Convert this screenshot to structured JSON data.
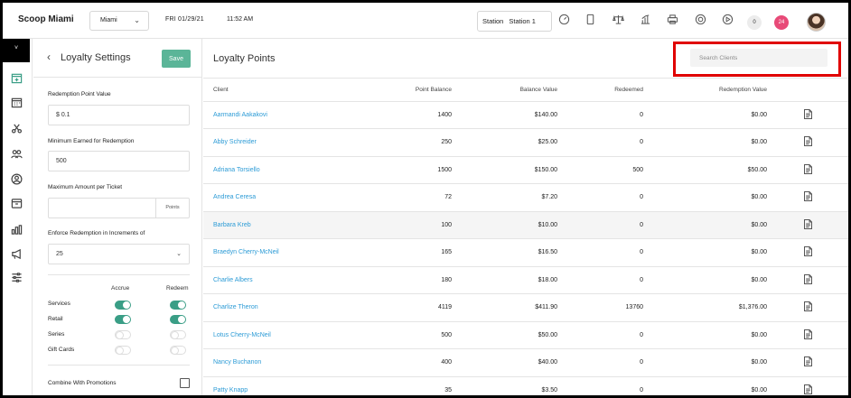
{
  "topbar": {
    "brand": "Scoop Miami",
    "location": "Miami",
    "date": "FRI 01/29/21",
    "time": "11:52 AM",
    "station_label": "Station",
    "station_value": "Station 1",
    "zero_badge": "0",
    "notification_count": "24",
    "icons": [
      "speedometer-icon",
      "tablet-icon",
      "scale-icon",
      "chart-icon",
      "printer-icon",
      "lifebuoy-icon",
      "play-icon"
    ]
  },
  "rail": {
    "toggle_label": "˅",
    "icons": [
      "calendar-plus-icon",
      "calendar-icon",
      "scissors-icon",
      "users-icon",
      "user-circle-icon",
      "box-icon",
      "bar-chart-icon",
      "megaphone-icon",
      "sliders-icon"
    ]
  },
  "settings": {
    "title": "Loyalty Settings",
    "save_label": "Save",
    "redemption_point_value_label": "Redemption Point Value",
    "redemption_point_value": "$ 0.1",
    "minimum_earned_label": "Minimum Earned for Redemption",
    "minimum_earned": "500",
    "max_amount_label": "Maximum Amount per Ticket",
    "max_amount": "",
    "max_amount_suffix": "Points",
    "increments_label": "Enforce Redemption in Increments of",
    "increments_value": "25",
    "accrue_label": "Accrue",
    "redeem_label": "Redeem",
    "categories": [
      {
        "label": "Services",
        "accrue": true,
        "redeem": true
      },
      {
        "label": "Retail",
        "accrue": true,
        "redeem": true
      },
      {
        "label": "Series",
        "accrue": false,
        "redeem": false
      },
      {
        "label": "Gift Cards",
        "accrue": false,
        "redeem": false
      }
    ],
    "combine_label": "Combine With Promotions",
    "combine_checked": false
  },
  "main": {
    "title": "Loyalty Points",
    "search_placeholder": "Search Clients",
    "columns": {
      "client": "Client",
      "point_balance": "Point Balance",
      "balance_value": "Balance Value",
      "redeemed": "Redeemed",
      "redemption_value": "Redemption Value"
    },
    "rows": [
      {
        "client": "Aarmandi Aakakovi",
        "points": "1400",
        "balance": "$140.00",
        "redeemed": "0",
        "redemption": "$0.00"
      },
      {
        "client": "Abby Schreider",
        "points": "250",
        "balance": "$25.00",
        "redeemed": "0",
        "redemption": "$0.00"
      },
      {
        "client": "Adriana Torsiello",
        "points": "1500",
        "balance": "$150.00",
        "redeemed": "500",
        "redemption": "$50.00"
      },
      {
        "client": "Andrea Ceresa",
        "points": "72",
        "balance": "$7.20",
        "redeemed": "0",
        "redemption": "$0.00"
      },
      {
        "client": "Barbara Kreb",
        "points": "100",
        "balance": "$10.00",
        "redeemed": "0",
        "redemption": "$0.00"
      },
      {
        "client": "Braedyn Cherry-McNeil",
        "points": "165",
        "balance": "$16.50",
        "redeemed": "0",
        "redemption": "$0.00"
      },
      {
        "client": "Charlie Albers",
        "points": "180",
        "balance": "$18.00",
        "redeemed": "0",
        "redemption": "$0.00"
      },
      {
        "client": "Charlize Theron",
        "points": "4119",
        "balance": "$411.90",
        "redeemed": "13760",
        "redemption": "$1,376.00"
      },
      {
        "client": "Lotus Cherry-McNeil",
        "points": "500",
        "balance": "$50.00",
        "redeemed": "0",
        "redemption": "$0.00"
      },
      {
        "client": "Nancy Buchanon",
        "points": "400",
        "balance": "$40.00",
        "redeemed": "0",
        "redemption": "$0.00"
      },
      {
        "client": "Patty Knapp",
        "points": "35",
        "balance": "$3.50",
        "redeemed": "0",
        "redemption": "$0.00"
      }
    ],
    "highlighted_row": 4
  },
  "colors": {
    "accent_green": "#3a9e86",
    "save_green": "#5bb598",
    "link_blue": "#2c9bd6",
    "badge_pink": "#e84a78",
    "highlight_red": "#e00000"
  }
}
